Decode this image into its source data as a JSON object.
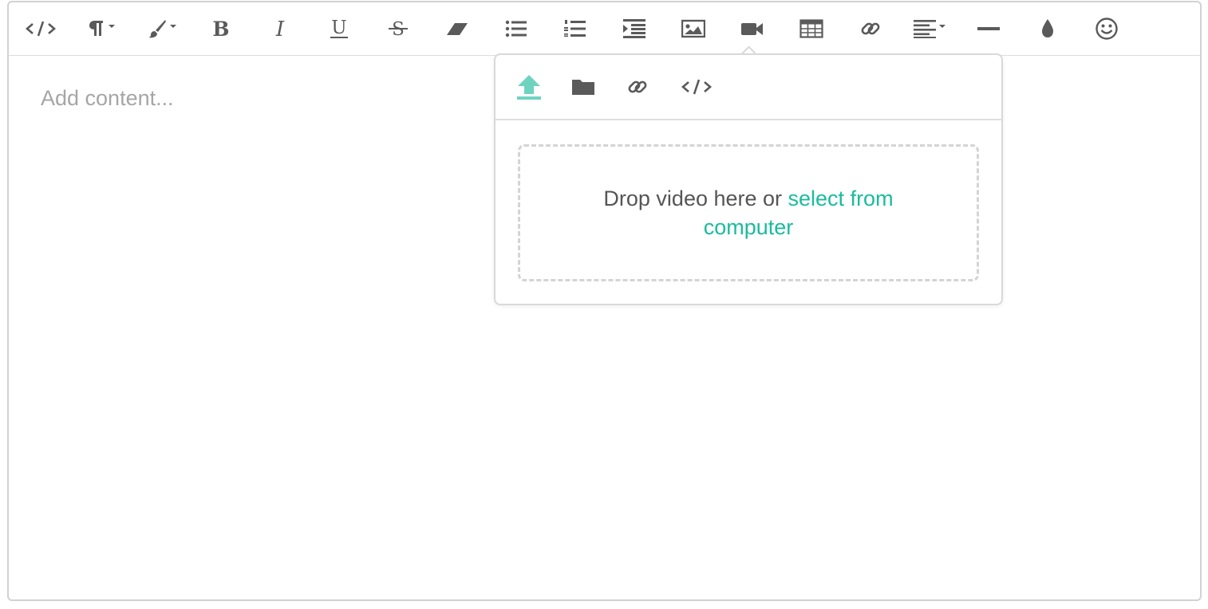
{
  "editor": {
    "placeholder": "Add content...",
    "toolbar": [
      {
        "name": "code-view-button",
        "icon": "code-icon"
      },
      {
        "name": "paragraph-format-button",
        "icon": "paragraph-icon"
      },
      {
        "name": "paragraph-style-button",
        "icon": "paintbrush-icon"
      },
      {
        "name": "bold-button",
        "icon": "bold-icon"
      },
      {
        "name": "italic-button",
        "icon": "italic-icon"
      },
      {
        "name": "underline-button",
        "icon": "underline-icon"
      },
      {
        "name": "strikethrough-button",
        "icon": "strikethrough-icon"
      },
      {
        "name": "clear-formatting-button",
        "icon": "eraser-icon"
      },
      {
        "name": "unordered-list-button",
        "icon": "bullet-list-icon"
      },
      {
        "name": "ordered-list-button",
        "icon": "numbered-list-icon"
      },
      {
        "name": "indent-button",
        "icon": "indent-icon"
      },
      {
        "name": "insert-image-button",
        "icon": "image-icon"
      },
      {
        "name": "insert-video-button",
        "icon": "video-icon"
      },
      {
        "name": "insert-table-button",
        "icon": "table-icon"
      },
      {
        "name": "insert-link-button",
        "icon": "link-icon"
      },
      {
        "name": "align-button",
        "icon": "align-left-icon"
      },
      {
        "name": "horizontal-line-button",
        "icon": "horizontal-line-icon"
      },
      {
        "name": "color-button",
        "icon": "droplet-icon"
      },
      {
        "name": "emoticons-button",
        "icon": "smiley-icon"
      }
    ]
  },
  "video_popup": {
    "tabs": [
      {
        "name": "upload-tab",
        "icon": "upload-icon",
        "active": true
      },
      {
        "name": "browse-tab",
        "icon": "folder-icon",
        "active": false
      },
      {
        "name": "by-url-tab",
        "icon": "link-icon",
        "active": false
      },
      {
        "name": "embed-tab",
        "icon": "code-icon",
        "active": false
      }
    ],
    "drop_text": "Drop video here or ",
    "select_link": "select from computer"
  },
  "colors": {
    "accent": "#1abc9c",
    "active_icon": "#6fd3c0",
    "icon": "#5a5a5a",
    "border": "#d2d2d2",
    "placeholder": "#a6a6a6"
  }
}
